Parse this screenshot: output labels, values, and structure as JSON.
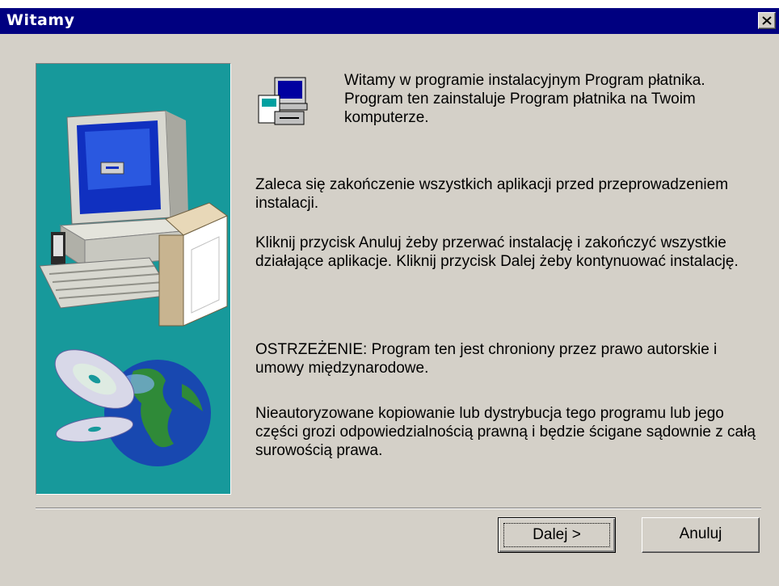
{
  "window": {
    "title": "Witamy"
  },
  "content": {
    "intro": "Witamy w programie instalacyjnym Program płatnika. Program ten zainstaluje Program płatnika na Twoim komputerze.",
    "close_apps": "Zaleca się zakończenie wszystkich aplikacji przed przeprowadzeniem instalacji.",
    "instructions": "Kliknij przycisk Anuluj żeby przerwać instalację i zakończyć wszystkie działające aplikacje.  Kliknij przycisk Dalej żeby kontynuować instalację.",
    "warning": "OSTRZEŻENIE: Program ten jest chroniony przez prawo autorskie i umowy międzynarodowe.",
    "legal": "Nieautoryzowane kopiowanie lub dystrybucja tego programu lub jego części grozi odpowiedzialnością prawną i będzie ścigane sądownie z całą surowością prawa."
  },
  "buttons": {
    "next_label": "Dalej >",
    "cancel_label": "Anuluj"
  },
  "icons": {
    "close": "close-icon",
    "setup": "setup-computer-icon",
    "art": "computer-box-globe-cd-illustration"
  },
  "colors": {
    "titlebar": "#000080",
    "panel": "#17999b",
    "dialog": "#d4d0c8"
  }
}
